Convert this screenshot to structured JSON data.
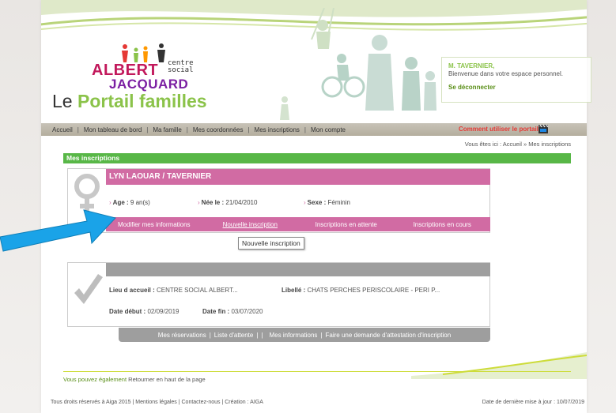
{
  "header": {
    "logo_albert": "ALBERT",
    "logo_jacquard": "JACQUARD",
    "logo_centre_line1": "centre",
    "logo_centre_line2": "social",
    "portal_prefix": "Le ",
    "portal_name": "Portail familles"
  },
  "welcome": {
    "name": "M. TAVERNIER,",
    "message": "Bienvenue dans votre espace personnel.",
    "logout": "Se déconnecter"
  },
  "nav": {
    "items": [
      "Accueil",
      "Mon tableau de bord",
      "Ma famille",
      "Mes coordonnées",
      "Mes inscriptions",
      "Mon compte"
    ],
    "help": "Comment utiliser le portail ?"
  },
  "breadcrumb": "Vous êtes ici : Accueil » Mes inscriptions",
  "section_title": "Mes inscriptions",
  "profile": {
    "name": "LYN LAOUAR / TAVERNIER",
    "age_label": "Age :",
    "age_value": "9 an(s)",
    "born_label": "Née le :",
    "born_value": "21/04/2010",
    "sex_label": "Sexe :",
    "sex_value": "Féminin",
    "tabs": [
      "Modifier mes informations",
      "Nouvelle inscription",
      "Inscriptions en attente",
      "Inscriptions en cours"
    ]
  },
  "tooltip": "Nouvelle inscription",
  "inscription": {
    "place_label": "Lieu d accueil :",
    "place_value": "CENTRE SOCIAL ALBERT...",
    "libelle_label": "Libellé :",
    "libelle_value": "CHATS PERCHES PERISCOLAIRE - PERI P...",
    "start_label": "Date début :",
    "start_value": "02/09/2019",
    "end_label": "Date fin :",
    "end_value": "03/07/2020",
    "tabs": [
      "Mes réservations",
      "Liste d'attente",
      "|",
      "Mes informations",
      "Faire une demande d'attestation d'inscription"
    ]
  },
  "bottom": {
    "also": "Vous pouvez également",
    "back_top": "Retourner en haut de la page"
  },
  "footer": {
    "left": "Tous droits réservés à Aiga 2015 | Mentions légales | Contactez-nous | Création : AIGA",
    "right": "Date de dernière mise à jour : 10/07/2019"
  },
  "colors": {
    "green": "#58b747",
    "pink": "#d16ba3",
    "grey": "#9e9e9e",
    "arrow": "#1aa3e8"
  }
}
